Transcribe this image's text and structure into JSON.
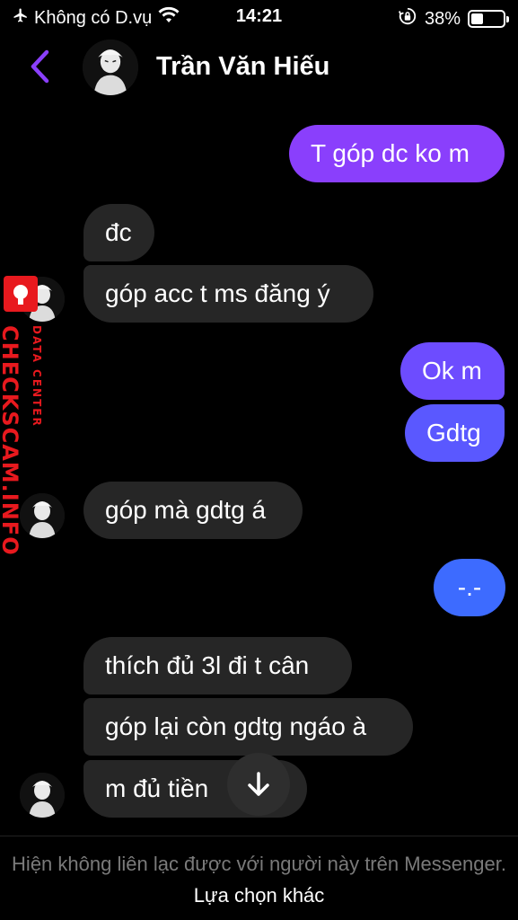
{
  "status_bar": {
    "carrier": "Không có D.vụ",
    "time": "14:21",
    "battery": "38%",
    "battery_level": 0.38
  },
  "header": {
    "contact_name": "Trần Văn Hiếu",
    "accent_color": "#8a3ffc"
  },
  "messages": [
    {
      "dir": "out",
      "text": "T góp dc ko m"
    },
    {
      "dir": "in",
      "text": "đc"
    },
    {
      "dir": "in",
      "text": "góp acc t ms đăng ý"
    },
    {
      "dir": "out",
      "text": "Ok m"
    },
    {
      "dir": "out",
      "text": "Gdtg"
    },
    {
      "dir": "in",
      "text": "góp mà gdtg á"
    },
    {
      "dir": "out",
      "text": "-.-"
    },
    {
      "dir": "in",
      "text": "thích đủ 3l đi t cân"
    },
    {
      "dir": "in",
      "text": "góp lại còn gdtg ngáo à"
    },
    {
      "dir": "in",
      "text": "m đủ tiền"
    }
  ],
  "watermark": {
    "main": "CHECKSCAM.INFO",
    "sub": "DATA CENTER",
    "color": "#e8191e"
  },
  "footer": {
    "notice": "Hiện không liên lạc được với người này trên Messenger.",
    "link": "Lựa chọn khác"
  },
  "bubble_colors": {
    "incoming": "#262626",
    "outgoing_top": "#8a3ffc",
    "outgoing_mid": "#6d4cff",
    "outgoing_bottom": "#3d6bff"
  }
}
